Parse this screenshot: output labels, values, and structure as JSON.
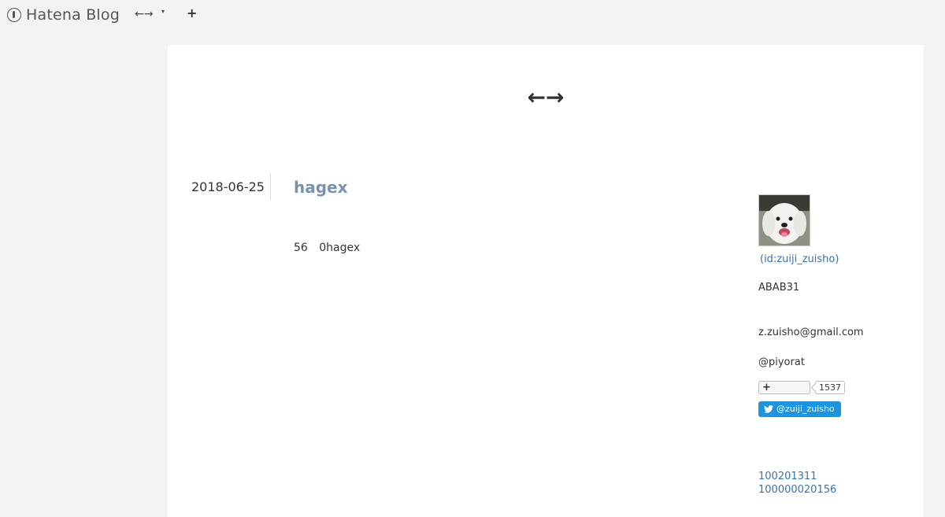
{
  "topbar": {
    "logo_text": "Hatena Blog",
    "blog_switch": "←→",
    "caret": "▾",
    "add": "+"
  },
  "blog": {
    "title": "←→"
  },
  "entry": {
    "date": "2018-06-25",
    "title": "hagex",
    "body": "56 0hagex"
  },
  "sidebar": {
    "profile_id": "(id:zuiji_zuisho)",
    "text1": "ABAB31",
    "email": "z.zuisho@gmail.com",
    "twitter_text": "@piyorat",
    "subscribe_icon": "+",
    "subscriber_count": "1537",
    "twitter_follow": "@zuiji_zuisho",
    "links": [
      "100201311",
      "100000020156"
    ]
  },
  "colors": {
    "background": "#f3f3f3",
    "card": "#ffffff",
    "entry_title": "#7892b0",
    "link": "#3673b0",
    "twitter": "#1b95e0"
  }
}
